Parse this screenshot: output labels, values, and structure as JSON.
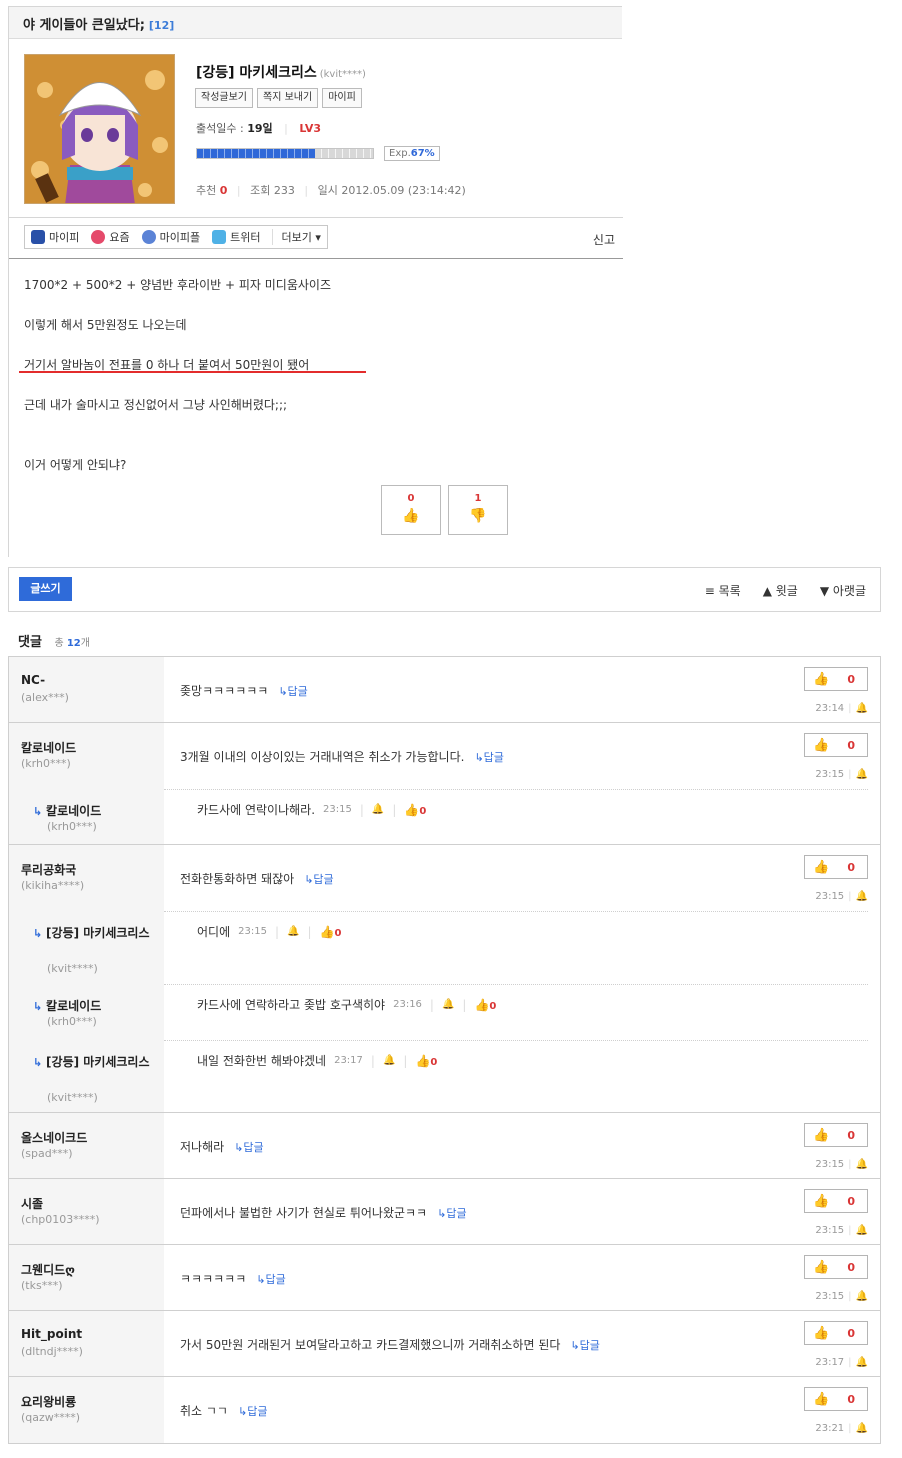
{
  "post": {
    "title": "야 게이들아 큰일났다;",
    "comment_count": "[12]",
    "author": "[강등] 마키세크리스",
    "author_id": "(kvit****)",
    "profile_buttons": [
      "작성글보기",
      "쪽지 보내기",
      "마이피"
    ],
    "attendance_label": "출석일수 :",
    "attendance_value": "19일",
    "level": "LV3",
    "exp_label": "Exp.",
    "exp_value": "67%",
    "exp_fraction": 0.67,
    "recommend_label": "추천",
    "recommend_value": "0",
    "views_label": "조회",
    "views_value": "233",
    "date_label": "일시",
    "date_value": "2012.05.09 (23:14:42)",
    "share": [
      "마이피",
      "요즘",
      "마이피플",
      "트위터"
    ],
    "share_more": "더보기 ▾",
    "report": "신고",
    "lines": [
      "1700*2 + 500*2 + 양념반 후라이반 + 피자 미디움사이즈",
      "이렇게 해서 5만원정도 나오는데",
      "거기서 알바놈이 전표를 0 하나 더 붙여서 50만원이 됐어",
      "근데 내가 술마시고 정신없어서 그냥 사인해버렸다;;;",
      "이거 어떻게 안되냐?"
    ],
    "upvotes": "0",
    "downvotes": "1"
  },
  "actions": {
    "write": "글쓰기",
    "list": "목록",
    "prev": "윗글",
    "next": "아랫글"
  },
  "comments_header": {
    "title": "댓글",
    "total_label": "총",
    "total_value": "12",
    "total_suffix": "개"
  },
  "reply_label": "↳답글",
  "comments": [
    {
      "author": "NC-",
      "id": "(alex***)",
      "text": "좆망ㅋㅋㅋㅋㅋㅋ",
      "likes": "0",
      "time": "23:14"
    },
    {
      "author": "칼로네이드",
      "id": "(krh0***)",
      "text": "3개월 이내의 이상이있는 거래내역은 취소가 가능합니다.",
      "likes": "0",
      "time": "23:15"
    },
    {
      "author": "루리공화국",
      "id": "(kikiha****)",
      "text": "전화한통화하면 돼잖아",
      "likes": "0",
      "time": "23:15"
    },
    {
      "author": "올스네이크드",
      "id": "(spad***)",
      "text": "저나해라",
      "likes": "0",
      "time": "23:15"
    },
    {
      "author": "시졸",
      "id": "(chp0103****)",
      "text": "던파에서나 불법한 사기가 현실로 튀어나왔군ㅋㅋ",
      "likes": "0",
      "time": "23:15"
    },
    {
      "author": "그웬디드ღ",
      "id": "(tks***)",
      "text": "ㅋㅋㅋㅋㅋㅋ",
      "likes": "0",
      "time": "23:15"
    },
    {
      "author": "Hit_point",
      "id": "(dltndj****)",
      "text": "가서 50만원 거래된거 보여달라고하고 카드결제했으니까 거래취소하면 된다",
      "likes": "0",
      "time": "23:17"
    },
    {
      "author": "요리왕비룡",
      "id": "(qazw****)",
      "text": "취소 ㄱㄱ",
      "likes": "0",
      "time": "23:21"
    }
  ],
  "subcomments": [
    {
      "author": "칼로네이드",
      "id": "(krh0***)",
      "text": "카드사에 연락이나해라.",
      "time": "23:15",
      "likes": "0"
    },
    {
      "author": "[강등] 마키세크리스",
      "id": "(kvit****)",
      "text": "어디에",
      "time": "23:15",
      "likes": "0"
    },
    {
      "author": "칼로네이드",
      "id": "(krh0***)",
      "text": "카드사에 연락하라고 좆밥 호구색히야",
      "time": "23:16",
      "likes": "0"
    },
    {
      "author": "[강등] 마키세크리스",
      "id": "(kvit****)",
      "text": "내일 전화한번 해봐야겠네",
      "time": "23:17",
      "likes": "0"
    }
  ],
  "colors": {
    "accent": "#2f6bd9",
    "red": "#d93535"
  }
}
